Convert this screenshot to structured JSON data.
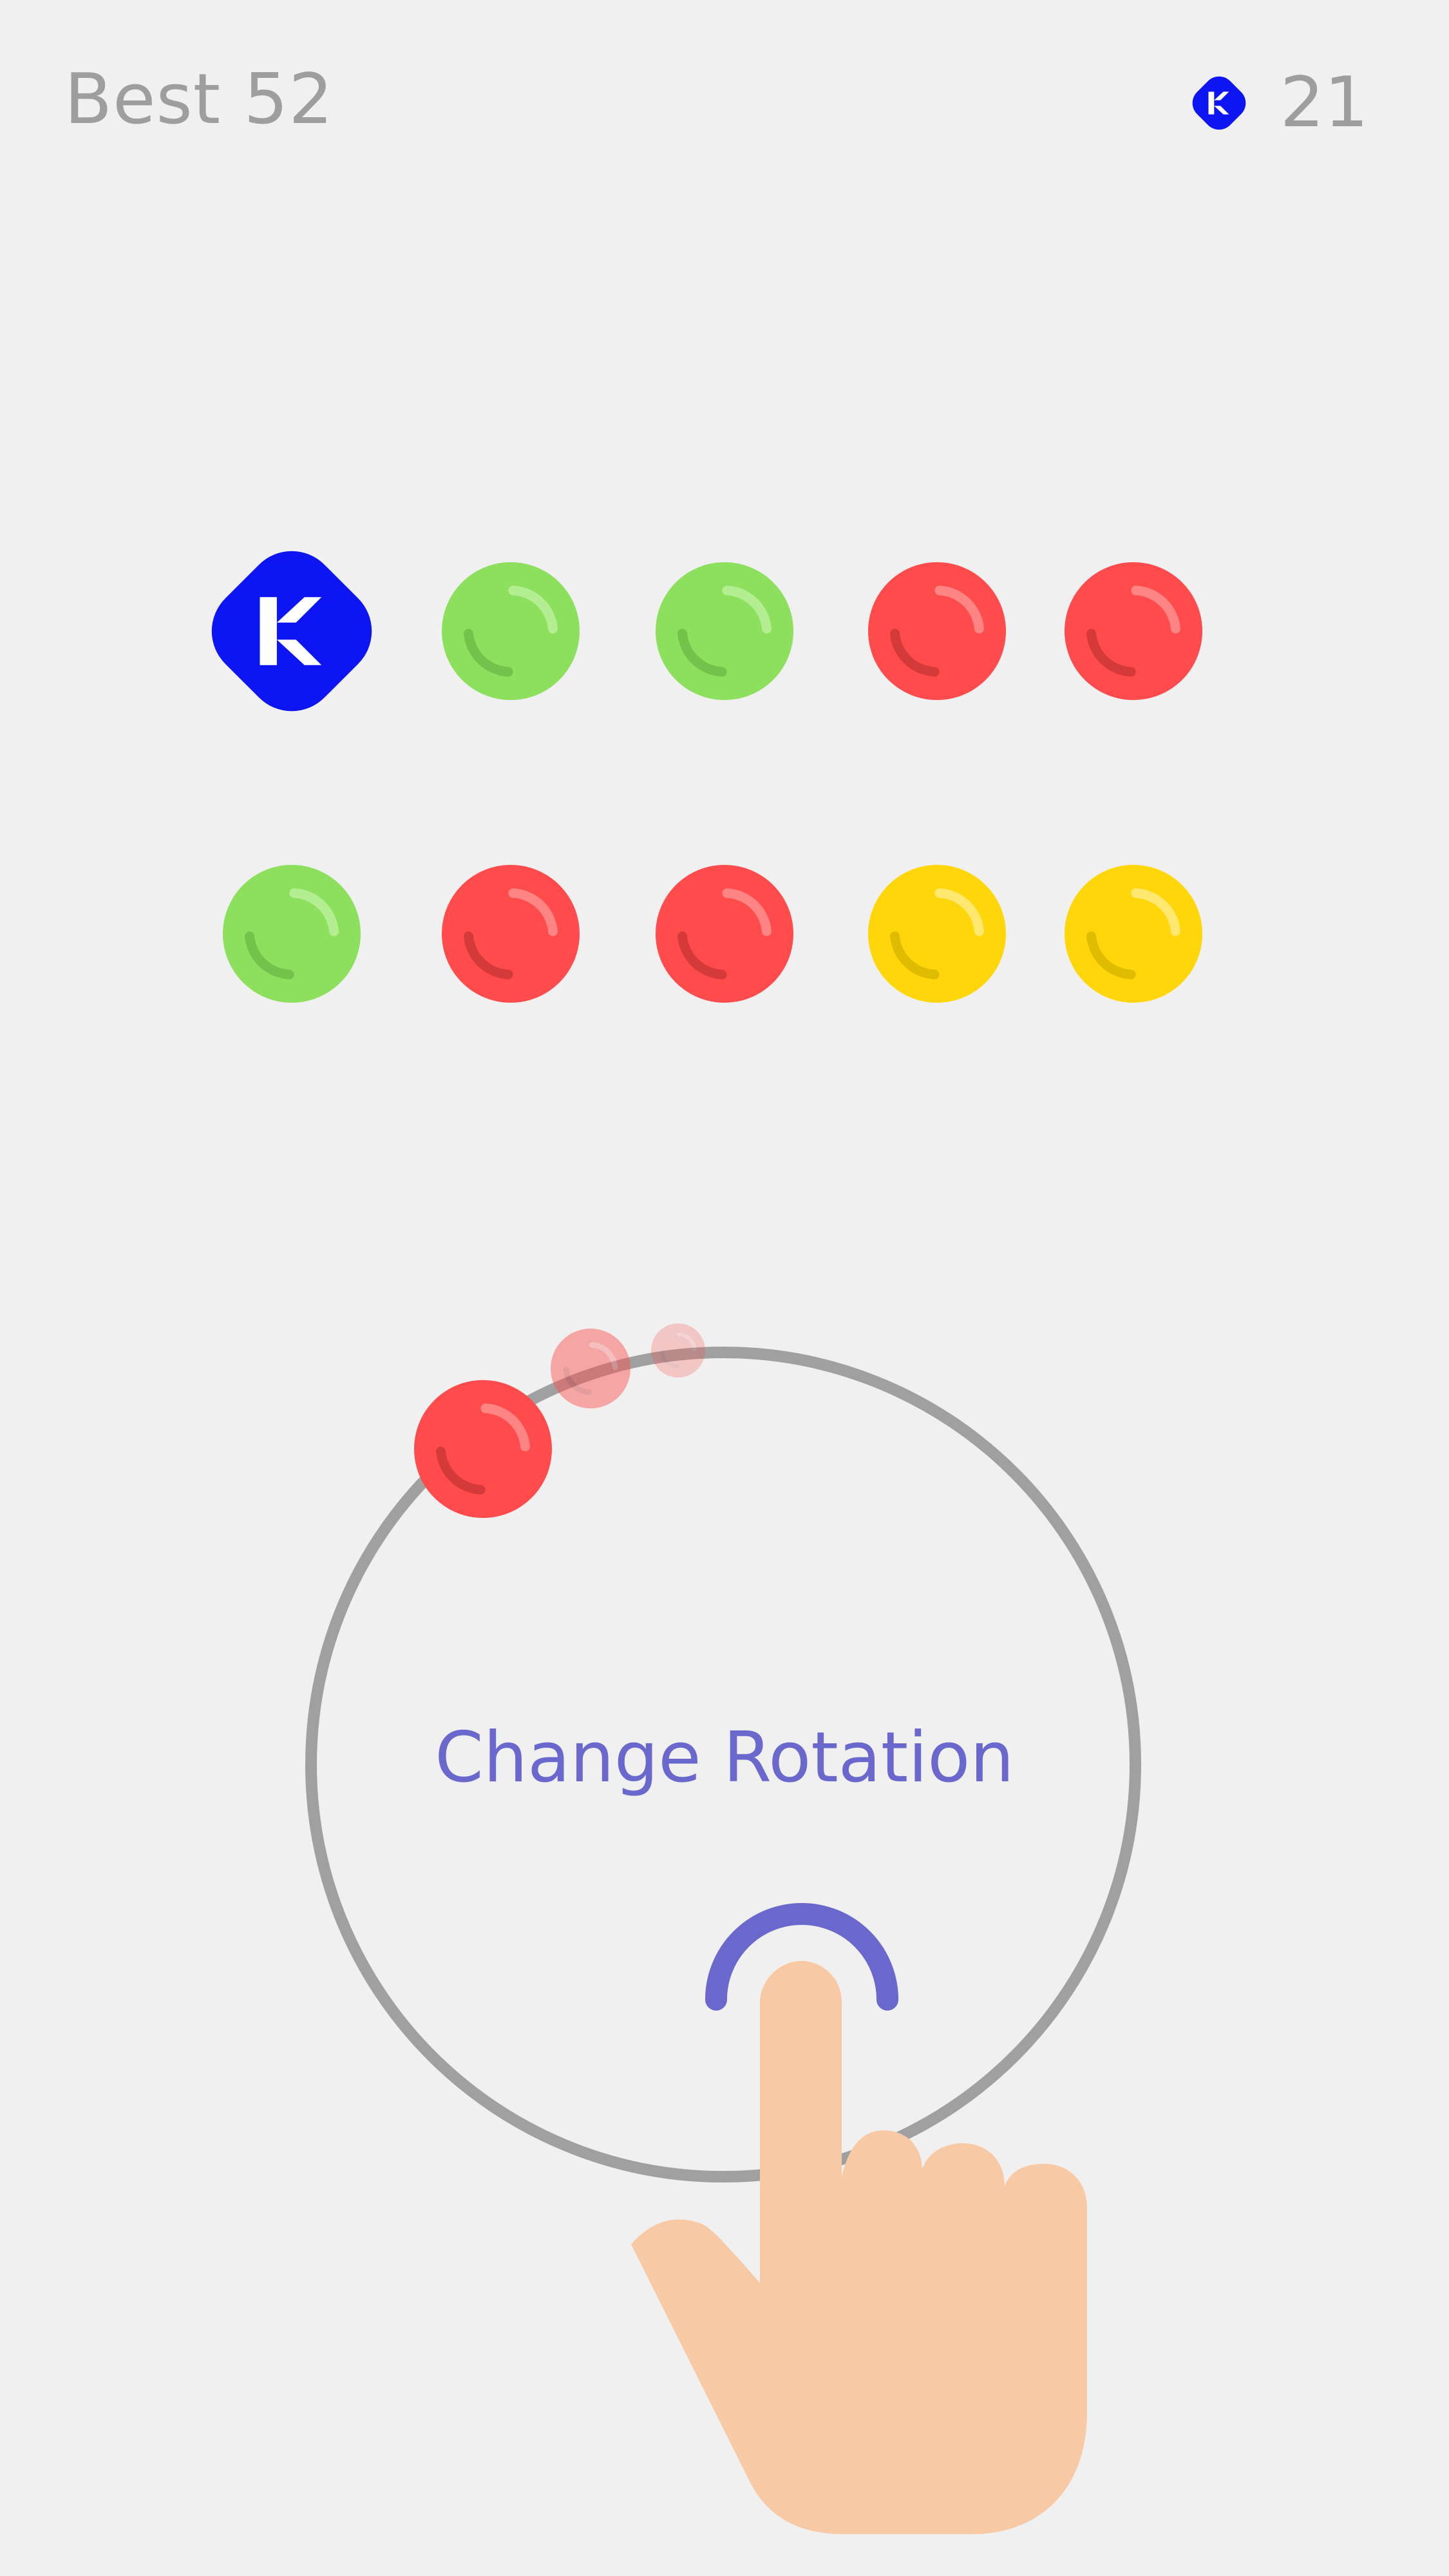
{
  "hud": {
    "best_label": "Best 52",
    "gem_count": "21",
    "gem_icon": "gem-icon"
  },
  "colors": {
    "background": "#f0f0f0",
    "red": "#ff4b4b",
    "green": "#8ddf5e",
    "yellow": "#ffd60a",
    "blue": "#0d16f2",
    "ring": "#a0a0a0",
    "hint": "#6a68cc",
    "skin": "#f7c9a5",
    "hud_text": "#9e9e9e"
  },
  "grid": {
    "rows": [
      [
        "gem",
        "green",
        "green",
        "red",
        "red"
      ],
      [
        "green",
        "red",
        "red",
        "yellow",
        "yellow"
      ]
    ]
  },
  "player": {
    "ball_color": "red",
    "trail_count": 2
  },
  "tutorial": {
    "label": "Change Rotation",
    "gesture_icon": "tap-hand-icon"
  }
}
